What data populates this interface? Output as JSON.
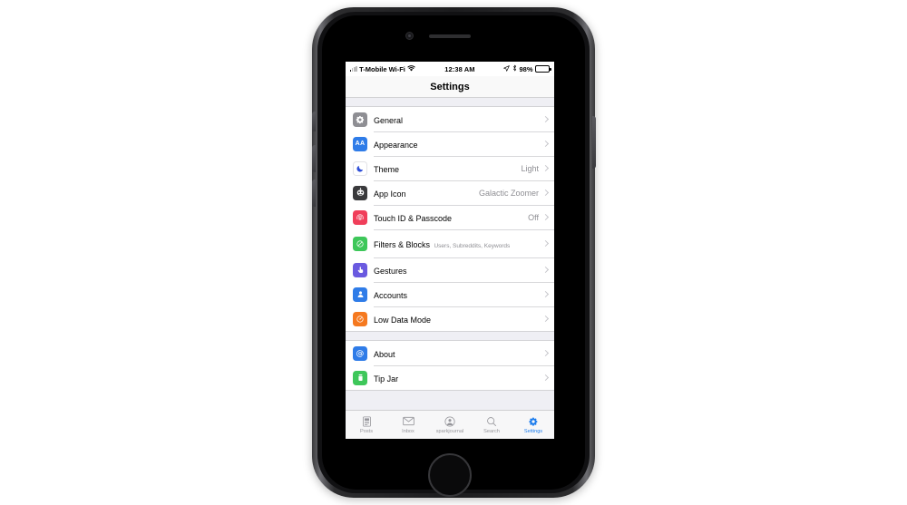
{
  "device": {
    "name": "iPhone",
    "body_color": "#1c1c1e"
  },
  "status_bar": {
    "carrier": "T-Mobile Wi-Fi",
    "time": "12:38 AM",
    "battery_percent": "98%",
    "wifi_icon": "wifi-icon",
    "location_icon": "location-arrow-icon",
    "bluetooth_icon": "bluetooth-icon",
    "signal_icon": "cellular-signal-icon",
    "battery_icon": "battery-icon",
    "battery_color": "#4cd964"
  },
  "nav": {
    "title": "Settings"
  },
  "groups": [
    {
      "rows": [
        {
          "title": "General",
          "value": "",
          "subtitle": "",
          "icon": "gear-icon",
          "icon_bg": "#8e8e93"
        },
        {
          "title": "Appearance",
          "value": "",
          "subtitle": "",
          "icon": "text-size-icon",
          "icon_bg": "#2f7ce8"
        },
        {
          "title": "Theme",
          "value": "Light",
          "subtitle": "",
          "icon": "moon-icon",
          "icon_bg": "#ffffff"
        },
        {
          "title": "App Icon",
          "value": "Galactic Zoomer",
          "subtitle": "",
          "icon": "robot-icon",
          "icon_bg": "#3a3a3c"
        },
        {
          "title": "Touch ID & Passcode",
          "value": "Off",
          "subtitle": "",
          "icon": "fingerprint-icon",
          "icon_bg": "#f03e5a"
        },
        {
          "title": "Filters & Blocks",
          "value": "",
          "subtitle": "Users, Subreddits, Keywords",
          "icon": "block-icon",
          "icon_bg": "#3ec75a"
        },
        {
          "title": "Gestures",
          "value": "",
          "subtitle": "",
          "icon": "hand-tap-icon",
          "icon_bg": "#6a5ae0"
        },
        {
          "title": "Accounts",
          "value": "",
          "subtitle": "",
          "icon": "person-icon",
          "icon_bg": "#2f7ce8"
        },
        {
          "title": "Low Data Mode",
          "value": "",
          "subtitle": "",
          "icon": "gauge-icon",
          "icon_bg": "#f5791f"
        }
      ]
    },
    {
      "rows": [
        {
          "title": "About",
          "value": "",
          "subtitle": "",
          "icon": "at-sign-icon",
          "icon_bg": "#2f7ce8"
        },
        {
          "title": "Tip Jar",
          "value": "",
          "subtitle": "",
          "icon": "jar-icon",
          "icon_bg": "#3ec75a"
        }
      ]
    }
  ],
  "tabs": [
    {
      "label": "Posts",
      "icon": "posts-icon",
      "active": false
    },
    {
      "label": "Inbox",
      "icon": "envelope-icon",
      "active": false
    },
    {
      "label": "sparkjournal",
      "icon": "account-circle-icon",
      "active": false
    },
    {
      "label": "Search",
      "icon": "magnifier-icon",
      "active": false
    },
    {
      "label": "Settings",
      "icon": "gear-icon",
      "active": true
    }
  ],
  "colors": {
    "accent": "#1d7ded",
    "list_bg": "#efeff4",
    "muted_text": "#8e8e93"
  }
}
